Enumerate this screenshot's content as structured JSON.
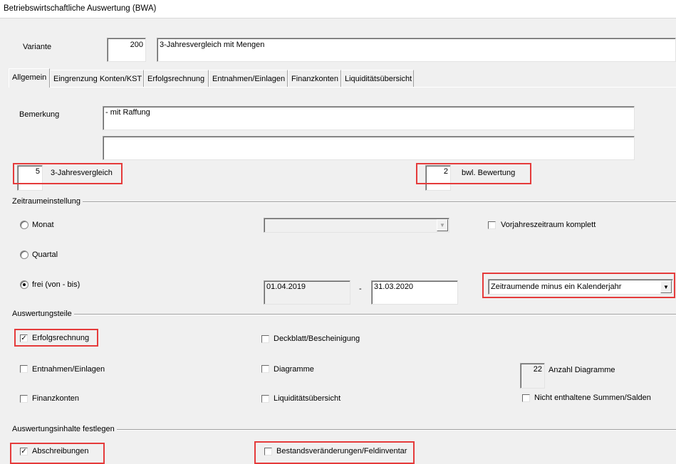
{
  "window": {
    "title": "Betriebswirtschaftliche Auswertung (BWA)"
  },
  "variante": {
    "label": "Variante",
    "number": "200",
    "name": "3-Jahresvergleich mit Mengen"
  },
  "tabs": [
    {
      "label": "Allgemein"
    },
    {
      "label": "Eingrenzung Konten/KST"
    },
    {
      "label": "Erfolgsrechnung"
    },
    {
      "label": "Entnahmen/Einlagen"
    },
    {
      "label": "Finanzkonten"
    },
    {
      "label": "Liquiditätsübersicht"
    }
  ],
  "bemerkung": {
    "label": "Bemerkung",
    "line1": "- mit Raffung",
    "line2": ""
  },
  "vergleich": {
    "value": "5",
    "label": "3-Jahresvergleich"
  },
  "bewertung": {
    "value": "2",
    "label": "bwl. Bewertung"
  },
  "zeitraum": {
    "group_title": "Zeitraumeinstellung",
    "radio_monat": "Monat",
    "radio_quartal": "Quartal",
    "radio_frei": "frei (von - bis)",
    "selected": "frei",
    "monat_select_value": "",
    "vorjahr_label": "Vorjahreszeitraum komplett",
    "vorjahr_checked": false,
    "from": "01.04.2019",
    "separator": "-",
    "to": "31.03.2020",
    "mode_select": "Zeitraumende minus ein Kalenderjahr"
  },
  "auswertungsteile": {
    "group_title": "Auswertungsteile",
    "erfolgsrechnung": {
      "label": "Erfolgsrechnung",
      "checked": true
    },
    "deckblatt": {
      "label": "Deckblatt/Bescheinigung",
      "checked": false
    },
    "entnahmen": {
      "label": "Entnahmen/Einlagen",
      "checked": false
    },
    "diagramme": {
      "label": "Diagramme",
      "checked": false
    },
    "anzahl_value": "22",
    "anzahl_label": "Anzahl Diagramme",
    "finanzkonten": {
      "label": "Finanzkonten",
      "checked": false
    },
    "liquiditaet": {
      "label": "Liquiditätsübersicht",
      "checked": false
    },
    "nicht_enthaltene": {
      "label": "Nicht enthaltene Summen/Salden",
      "checked": false
    }
  },
  "auswertungsinhalte": {
    "group_title": "Auswertungsinhalte festlegen",
    "abschreibungen": {
      "label": "Abschreibungen",
      "checked": true
    },
    "bestand": {
      "label": "Bestandsveränderungen/Feldinventar",
      "checked": false
    }
  },
  "colors": {
    "highlight": "#e53b3b",
    "window_bg": "#f0f0f0"
  }
}
